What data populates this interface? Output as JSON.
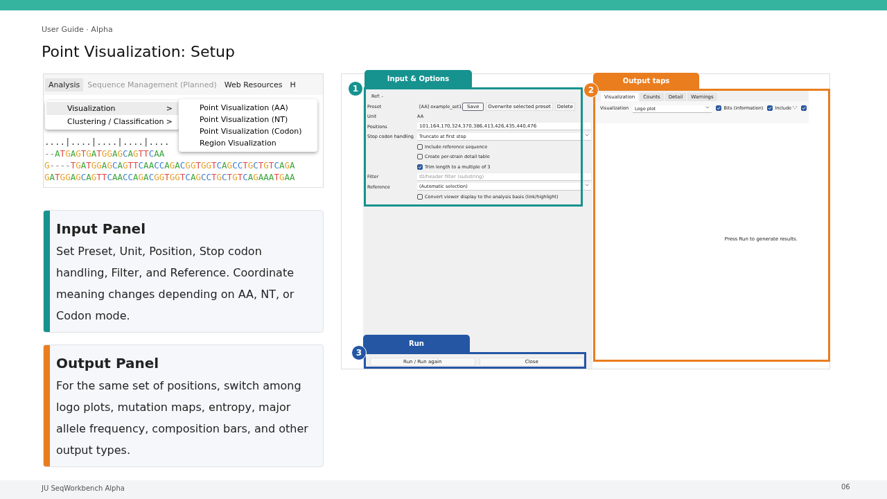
{
  "header": {
    "breadcrumb": "User Guide · Alpha",
    "title": "Point Visualization: Setup"
  },
  "menu_shot": {
    "menubar": [
      {
        "label": "Analysis",
        "selected": true,
        "disabled": false
      },
      {
        "label": "Sequence Management (Planned)",
        "selected": false,
        "disabled": true
      },
      {
        "label": "Web Resources",
        "selected": false,
        "disabled": false
      },
      {
        "label": "H",
        "selected": false,
        "disabled": false
      }
    ],
    "menu": [
      {
        "label": "Visualization",
        "arrow": ">",
        "selected": true
      },
      {
        "label": "Clustering / Classification",
        "arrow": ">",
        "selected": false
      }
    ],
    "submenu": [
      "Point Visualization (AA)",
      "Point Visualization (NT)",
      "Point Visualization (Codon)",
      "Region Visualization"
    ],
    "ruler": "....|....|....|....|....",
    "sequences": [
      "--ATGAGTGATGGAGCAGTTCAA",
      "G----TGATGGAGCAGTTCAACCAGACGGTGGTCAGCCTGCTGTCAGA",
      "GATGGAGCAGTTCAACCAGACGGTGGTCAGCCTGCTGTCAGAAATGAA"
    ]
  },
  "cards": [
    {
      "title": "Input Panel",
      "text": "Set Preset, Unit, Position, Stop codon handling, Filter, and Reference. Coordinate meaning changes depending on AA, NT, or Codon mode.",
      "color": "#16928f"
    },
    {
      "title": "Output Panel",
      "text": "For the same set of positions, switch among logo plots, mutation maps, entropy, major allele frequency, composition bars, and other output types.",
      "color": "#ea7d1e"
    }
  ],
  "app": {
    "callouts": [
      {
        "number": "1",
        "label": "Input & Options",
        "color": "#16928f"
      },
      {
        "number": "2",
        "label": "Output taps",
        "color": "#ea7d1e"
      },
      {
        "number": "3",
        "label": "Run",
        "color": "#2456a4"
      }
    ],
    "input": {
      "ref": "Ref: -",
      "rows": [
        {
          "kind": "preset",
          "label": "Preset",
          "value": "[AA] example_set1",
          "buttons": [
            "Save",
            "Overwrite selected preset",
            "Delete"
          ]
        },
        {
          "kind": "text",
          "label": "Unit",
          "value": "AA"
        },
        {
          "kind": "field",
          "label": "Positions",
          "value": "101,164,170,324,370,386,413,426,435,440,476"
        },
        {
          "kind": "select",
          "label": "Stop codon handling",
          "value": "Truncate at first stop"
        },
        {
          "kind": "check",
          "label": "Include reference sequence",
          "checked": false
        },
        {
          "kind": "check",
          "label": "Create per-strain detail table",
          "checked": false
        },
        {
          "kind": "check",
          "label": "Trim length to a multiple of 3",
          "checked": true
        },
        {
          "kind": "field",
          "label": "Filter",
          "placeholder": "ID/header filter (substring)"
        },
        {
          "kind": "select",
          "label": "Reference",
          "value": "(Automatic selection)"
        },
        {
          "kind": "check",
          "label": "Convert viewer display to the analysis basis (link/highlight)",
          "checked": false
        }
      ]
    },
    "output": {
      "tabs": [
        {
          "label": "Visualization",
          "selected": true
        },
        {
          "label": "Counts",
          "selected": false
        },
        {
          "label": "Detail",
          "selected": false
        },
        {
          "label": "Warnings",
          "selected": false
        }
      ],
      "label": "Visualization",
      "select": "Logo plot",
      "options": [
        {
          "label": "Bits (information)",
          "checked": true
        },
        {
          "label": "Include '-'",
          "checked": true
        },
        {
          "checked": true
        }
      ],
      "message": "Press Run to generate results."
    },
    "run": {
      "buttons": [
        "Run / Run again",
        "Close"
      ]
    }
  },
  "footer": {
    "brand": "JU SeqWorkbench Alpha",
    "page": "06"
  }
}
